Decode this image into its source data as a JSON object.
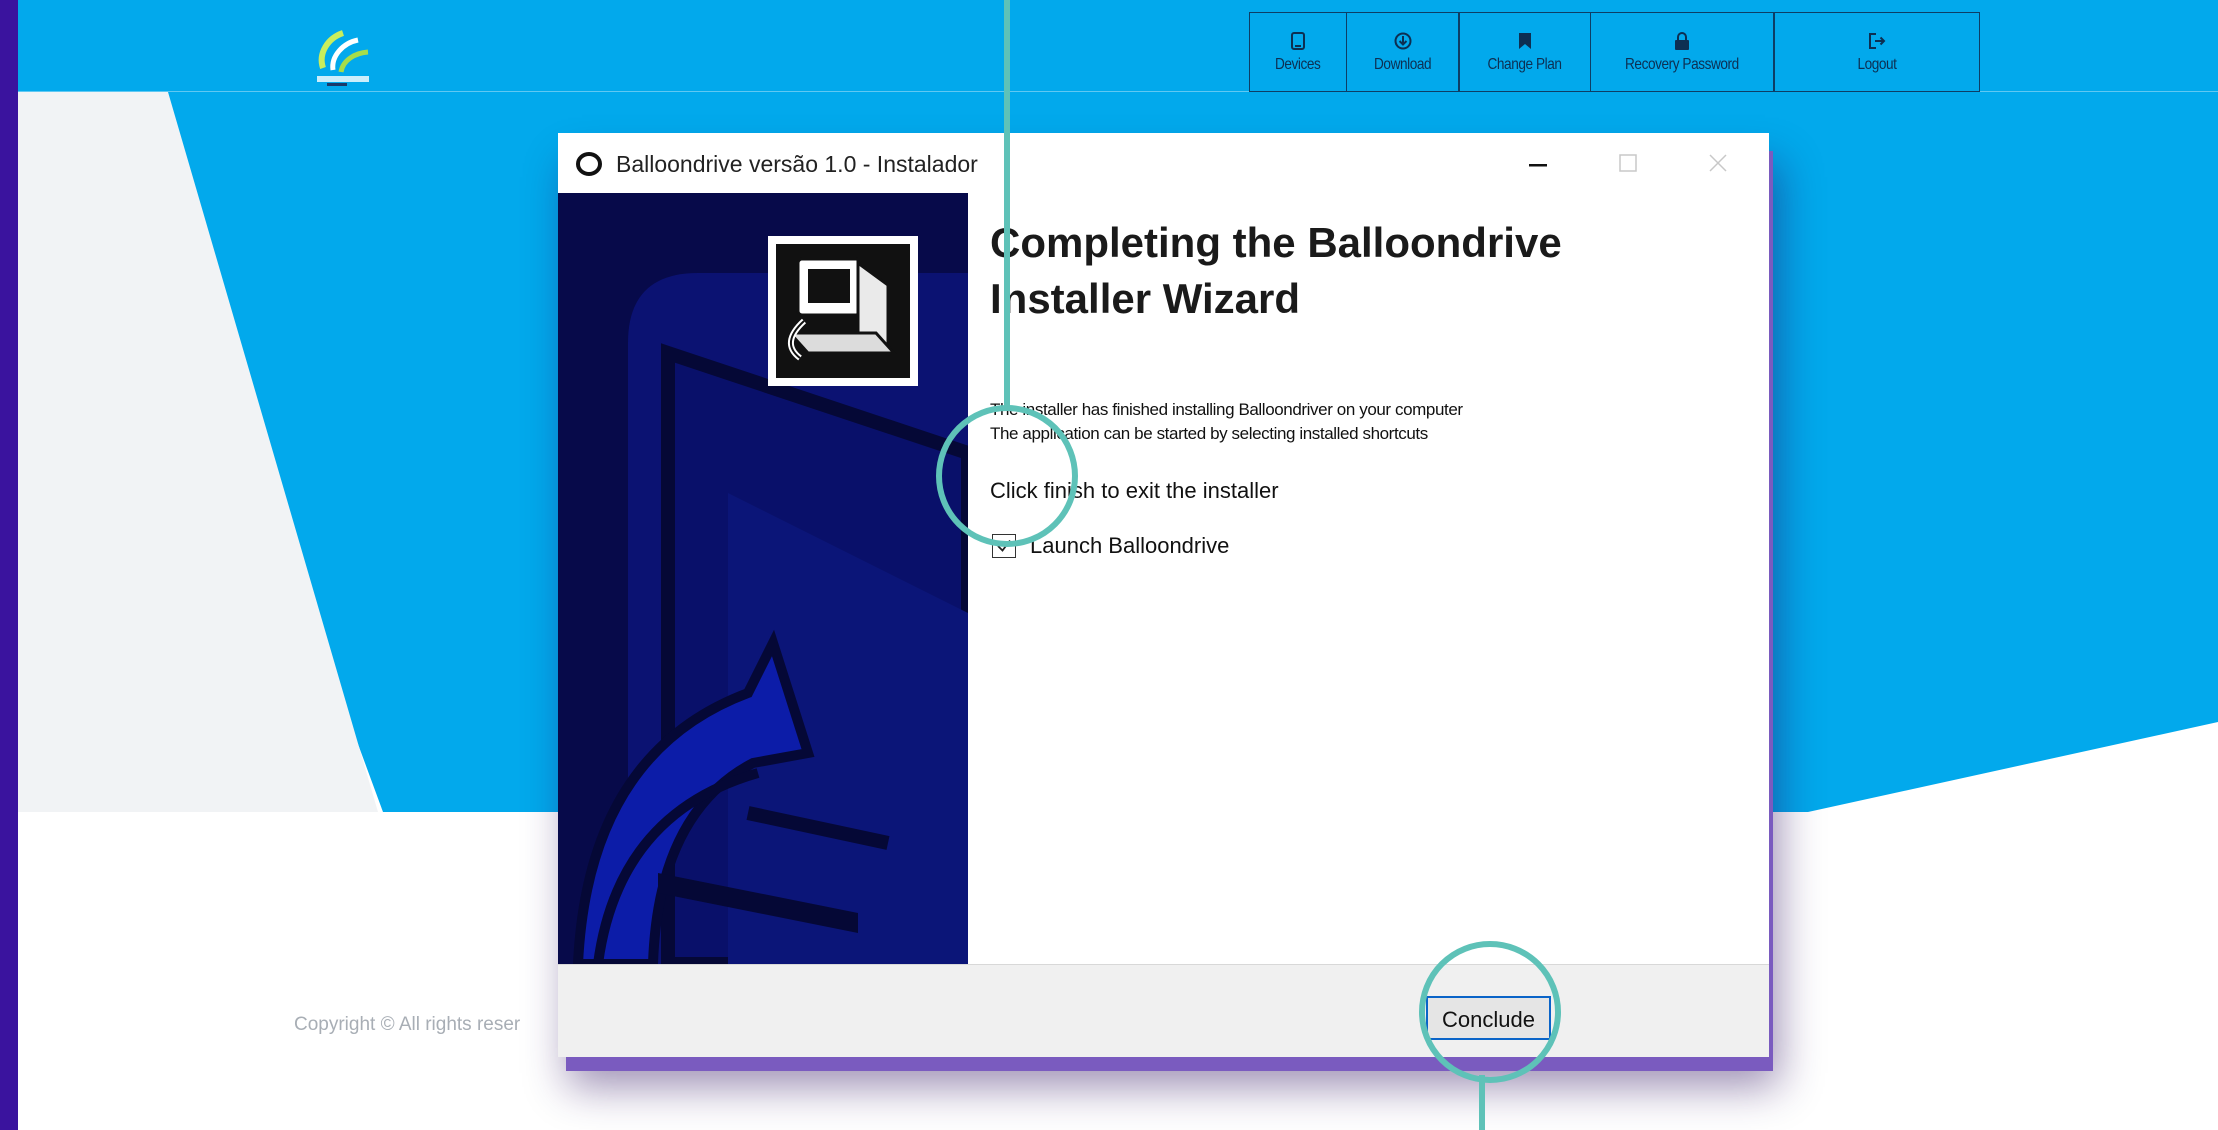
{
  "header": {
    "nav": [
      {
        "icon": "phone-icon",
        "label": "Devices"
      },
      {
        "icon": "download-icon",
        "label": "Download"
      },
      {
        "icon": "bookmark-icon",
        "label": "Change Plan"
      },
      {
        "icon": "lock-icon",
        "label": "Recovery Password"
      },
      {
        "icon": "logout-icon",
        "label": "Logout"
      }
    ]
  },
  "footer": {
    "copyright": "Copyright © All rights reser"
  },
  "installer": {
    "title": "Balloondrive versão 1.0 - Instalador",
    "heading": "Completing the Balloondrive Installer Wizard",
    "description_line1": "The installer has finished installing Balloondriver on your computer",
    "description_line2": "The application can be started by selecting installed shortcuts",
    "instruction": "Click finish to exit the installer",
    "launch_checkbox": {
      "label": "Launch Balloondrive",
      "checked": true
    },
    "conclude_label": "Conclude"
  },
  "colors": {
    "frame": "#3a139e",
    "header": "#02a9ec",
    "banner": "#070a4a",
    "annotation": "#5ec2b8"
  }
}
